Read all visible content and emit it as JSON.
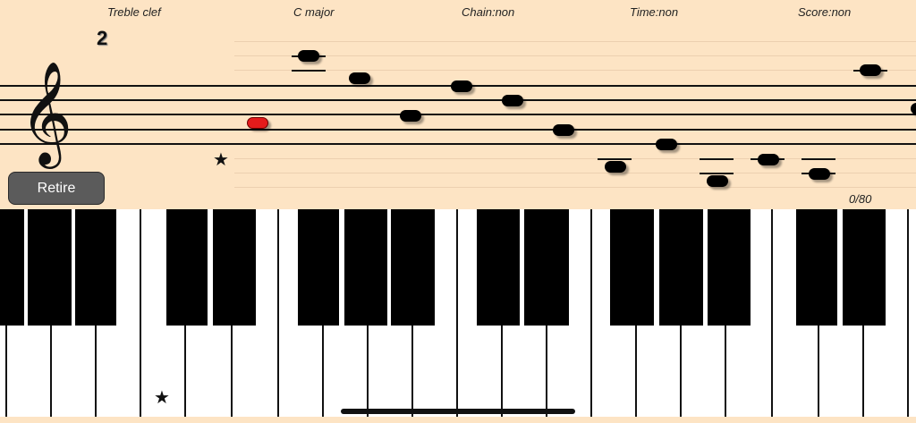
{
  "header": {
    "clef_label": "Treble clef",
    "key_label": "C major",
    "chain_label": "Chain:non",
    "time_label": "Time:non",
    "score_label": "Score:non"
  },
  "level": "2",
  "clef_symbol": "𝄞",
  "star_symbol": "★",
  "retire_button": {
    "label": "Retire"
  },
  "progress": "0/80",
  "colors": {
    "background": "#fde4c4",
    "current_note": "#e51b1b",
    "note": "#000000",
    "button": "#5b5b5b"
  }
}
